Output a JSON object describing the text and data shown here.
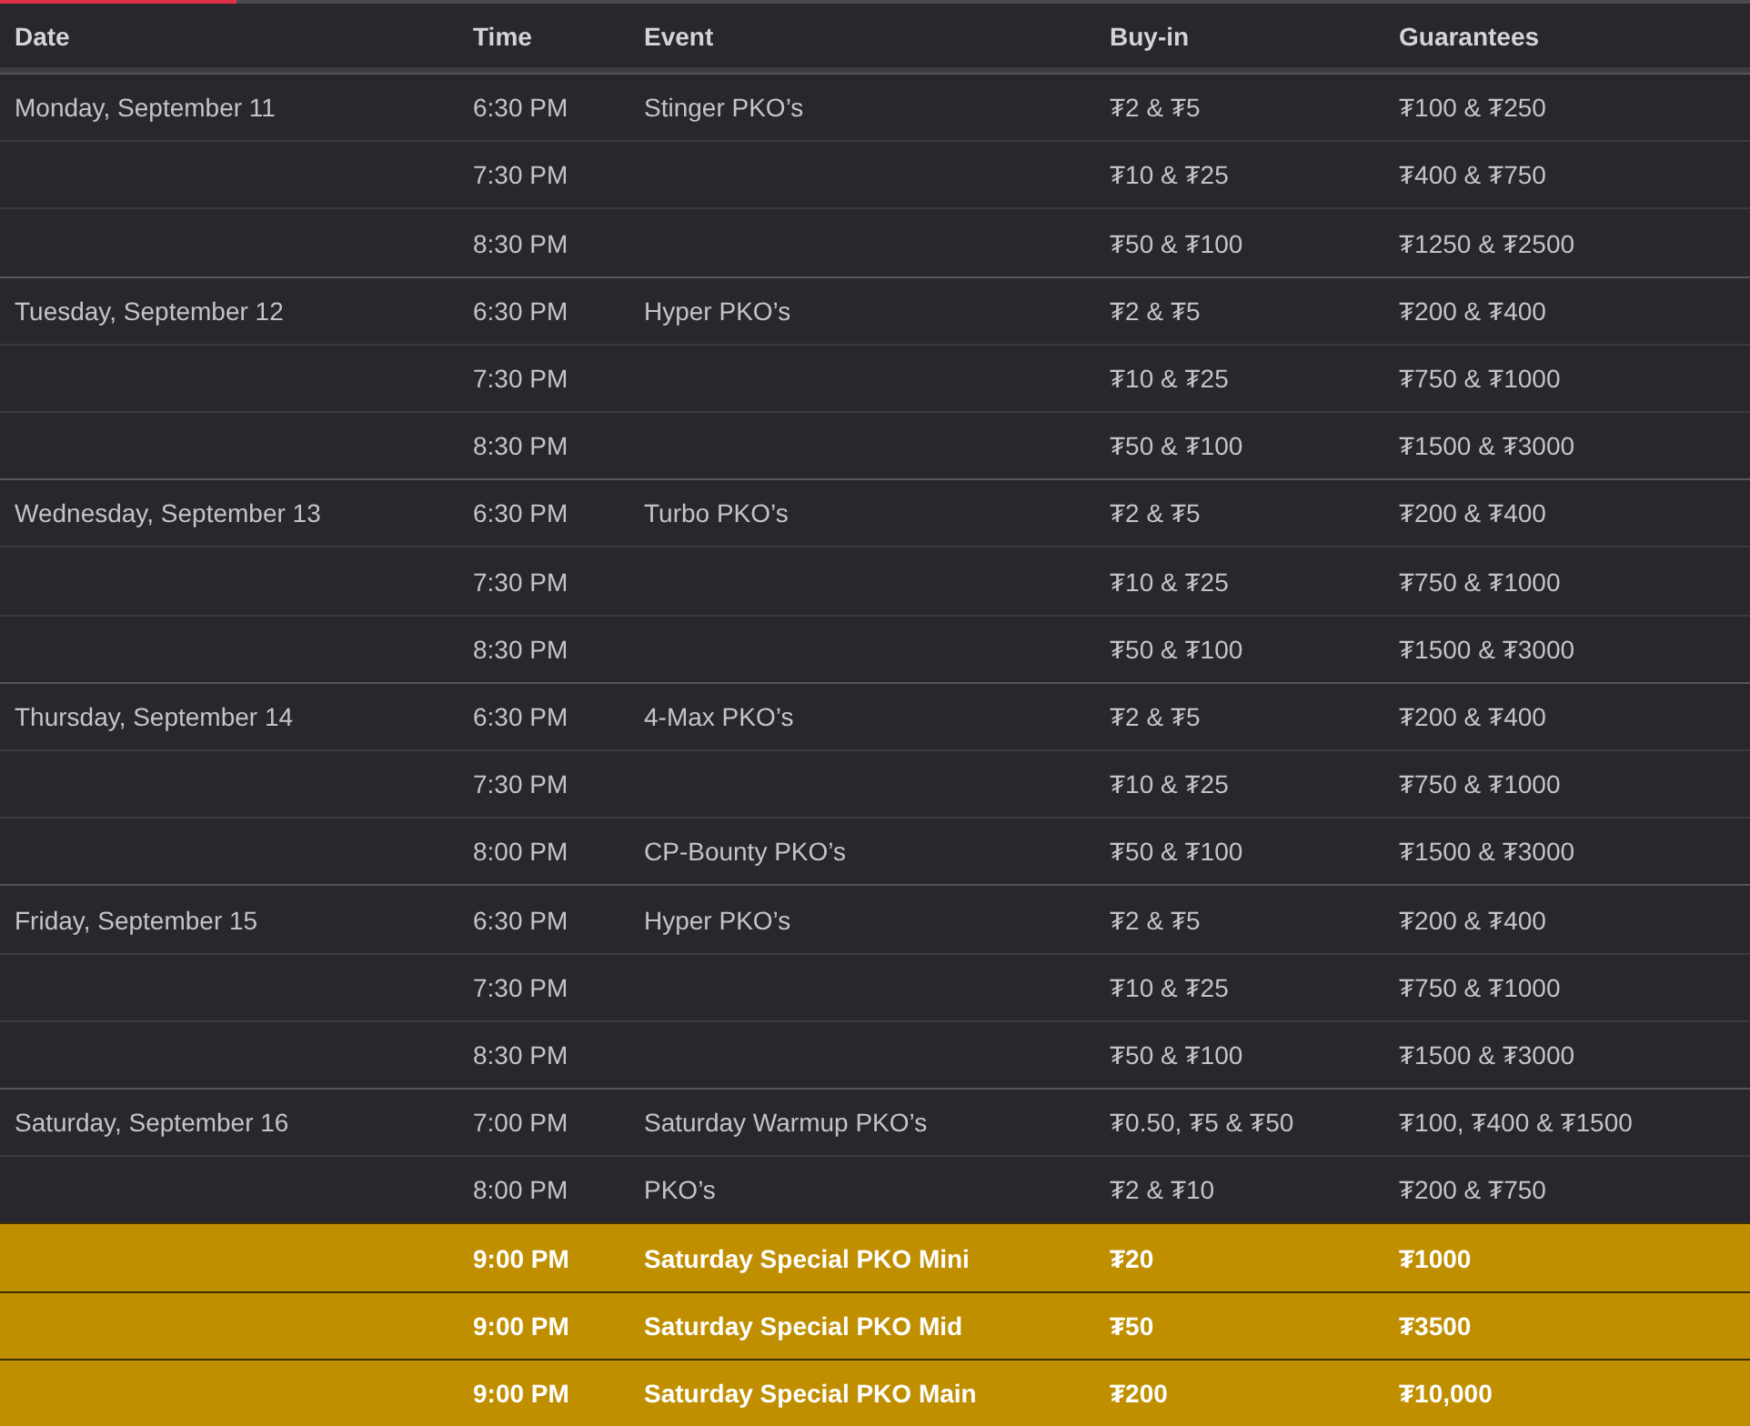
{
  "table": {
    "columns": [
      "Date",
      "Time",
      "Event",
      "Buy-in",
      "Guarantees"
    ],
    "rows": [
      {
        "date": "Monday, September 11",
        "time": "6:30 PM",
        "event": "Stinger PKO’s",
        "buy_in": "₮2 & ₮5",
        "guarantees": "₮100 & ₮250",
        "featured": false
      },
      {
        "time": "7:30 PM",
        "buy_in": "₮10 & ₮25",
        "guarantees": "₮400 & ₮750",
        "featured": false
      },
      {
        "time": "8:30 PM",
        "buy_in": "₮50 & ₮100",
        "guarantees": "₮1250 & ₮2500",
        "featured": false
      },
      {
        "date": "Tuesday, September 12",
        "time": "6:30 PM",
        "event": "Hyper PKO’s",
        "buy_in": "₮2 & ₮5",
        "guarantees": "₮200 & ₮400",
        "featured": false
      },
      {
        "time": "7:30 PM",
        "buy_in": "₮10 & ₮25",
        "guarantees": "₮750 & ₮1000",
        "featured": false
      },
      {
        "time": "8:30 PM",
        "buy_in": "₮50 & ₮100",
        "guarantees": "₮1500 & ₮3000",
        "featured": false
      },
      {
        "date": "Wednesday, September 13",
        "time": "6:30 PM",
        "event": "Turbo PKO’s",
        "buy_in": "₮2 & ₮5",
        "guarantees": "₮200 & ₮400",
        "featured": false
      },
      {
        "time": "7:30 PM",
        "buy_in": "₮10 & ₮25",
        "guarantees": "₮750 & ₮1000",
        "featured": false
      },
      {
        "time": "8:30 PM",
        "buy_in": "₮50 & ₮100",
        "guarantees": "₮1500 & ₮3000",
        "featured": false
      },
      {
        "date": "Thursday, September 14",
        "time": "6:30 PM",
        "event": "4-Max PKO’s",
        "buy_in": "₮2 & ₮5",
        "guarantees": "₮200 & ₮400",
        "featured": false
      },
      {
        "time": "7:30 PM",
        "buy_in": "₮10 & ₮25",
        "guarantees": "₮750 & ₮1000",
        "featured": false
      },
      {
        "time": "8:00 PM",
        "event": "CP-Bounty PKO’s",
        "buy_in": "₮50 & ₮100",
        "guarantees": "₮1500 & ₮3000",
        "featured": false
      },
      {
        "date": "Friday, September 15",
        "time": "6:30 PM",
        "event": "Hyper PKO’s",
        "buy_in": "₮2 & ₮5",
        "guarantees": "₮200 & ₮400",
        "featured": false
      },
      {
        "time": "7:30 PM",
        "buy_in": "₮10 & ₮25",
        "guarantees": "₮750 & ₮1000",
        "featured": false
      },
      {
        "time": "8:30 PM",
        "buy_in": "₮50 & ₮100",
        "guarantees": "₮1500 & ₮3000",
        "featured": false
      },
      {
        "date": "Saturday, September 16",
        "time": "7:00 PM",
        "event": "Saturday Warmup PKO’s",
        "buy_in": "₮0.50, ₮5 & ₮50",
        "guarantees": "₮100, ₮400 & ₮1500",
        "featured": false
      },
      {
        "time": "8:00 PM",
        "event": "PKO’s",
        "buy_in": "₮2 & ₮10",
        "guarantees": "₮200 & ₮750",
        "featured": false
      },
      {
        "time": "9:00 PM",
        "event": "Saturday Special PKO Mini",
        "buy_in": "₮20",
        "guarantees": "₮1000",
        "featured": true
      },
      {
        "time": "9:00 PM",
        "event": "Saturday Special PKO Mid",
        "buy_in": "₮50",
        "guarantees": "₮3500",
        "featured": true
      },
      {
        "time": "9:00 PM",
        "event": "Saturday Special PKO Main",
        "buy_in": "₮200",
        "guarantees": "₮10,000",
        "featured": true
      }
    ]
  }
}
